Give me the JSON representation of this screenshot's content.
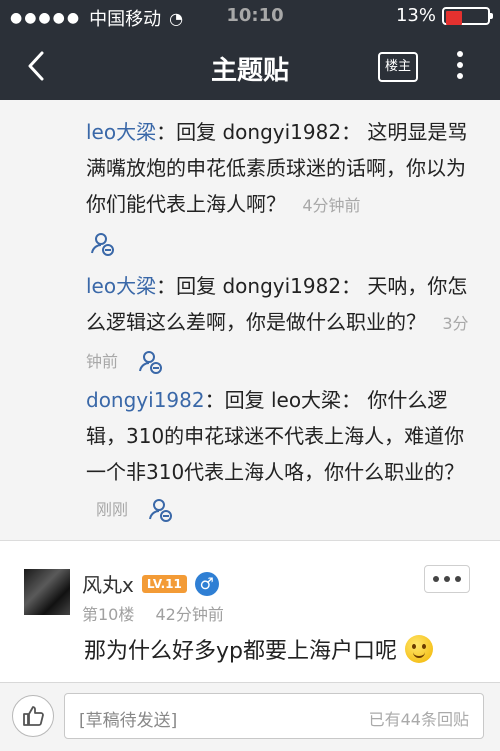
{
  "status_bar": {
    "carrier": "中国移动",
    "time": "10:10",
    "battery": "13%"
  },
  "nav": {
    "title": "主题贴",
    "owner_button": "楼主"
  },
  "replies": [
    {
      "user": "leo大梁",
      "prefix": "：回复",
      "target": "dongyi1982",
      "text": "：  这明显是骂满嘴放炮的申花低素质球迷的话啊，你以为你们能代表上海人啊？",
      "time": "4分钟前"
    },
    {
      "user": "leo大梁",
      "prefix": "：回复",
      "target": "dongyi1982",
      "text": "：  天呐，你怎么逻辑这么差啊，你是做什么职业的？",
      "time": "3分钟前"
    },
    {
      "user": "dongyi1982",
      "prefix": "：回复",
      "target": "leo大梁",
      "text": "：  你什么逻辑，310的申花球迷不代表上海人，难道你一个非310代表上海人咯，你什么职业的？",
      "time": "刚刚"
    }
  ],
  "post": {
    "author": "风丸x",
    "level": "LV.11",
    "gender": "♂",
    "floor": "第10楼",
    "time": "42分钟前",
    "content": "那为什么好多yp都要上海户口呢"
  },
  "bottom": {
    "placeholder": "[草稿待发送]",
    "reply_count": "已有44条回贴"
  }
}
